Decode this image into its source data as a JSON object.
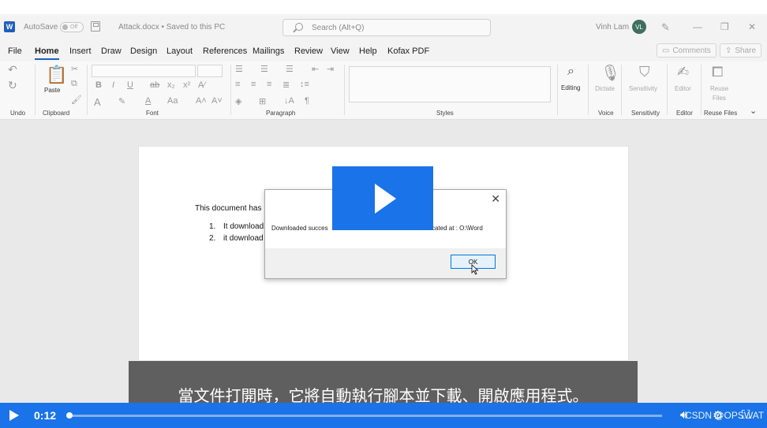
{
  "app": {
    "autosave_label": "AutoSave",
    "autosave_state": "Off",
    "doc_title": "Attack.docx • Saved to this PC",
    "search_placeholder": "Search (Alt+Q)",
    "user_name": "Vinh Lam",
    "user_initials": "VL"
  },
  "menu": {
    "tabs": [
      "File",
      "Home",
      "Insert",
      "Draw",
      "Design",
      "Layout",
      "References",
      "Mailings",
      "Review",
      "View",
      "Help",
      "Kofax PDF"
    ],
    "active_tab": "Home",
    "comments_label": "Comments",
    "share_label": "Share"
  },
  "ribbon": {
    "groups": {
      "undo": "Undo",
      "clipboard": "Clipboard",
      "font": "Font",
      "paragraph": "Paragraph",
      "styles": "Styles",
      "voice": "Voice",
      "sensitivity": "Sensitivity",
      "editor": "Editor",
      "reuse_files": "Reuse Files"
    },
    "paste_label": "Paste",
    "editing_label": "Editing",
    "dictate_label": "Dictate",
    "sensitivity_label": "Sensitivity",
    "editor_label": "Editor",
    "reuse_label_1": "Reuse",
    "reuse_label_2": "Files"
  },
  "document": {
    "intro": "This document has",
    "items": [
      {
        "num": "1.",
        "text": "It download"
      },
      {
        "num": "2.",
        "text": "it download"
      }
    ]
  },
  "dialog": {
    "message_start": "Downloaded succes",
    "message_end": "cated at : O:\\Word",
    "ok_label": "OK",
    "close_glyph": "✕"
  },
  "subtitle": {
    "text": "當文件打開時，它將自動執行腳本並下載、開啟應用程式。"
  },
  "player": {
    "time": "0:12",
    "progress": 0.004,
    "watermark": "CSDN @OPSWAT"
  },
  "colors": {
    "player_blue": "#1a73e8",
    "word_blue": "#1f5fbf"
  }
}
